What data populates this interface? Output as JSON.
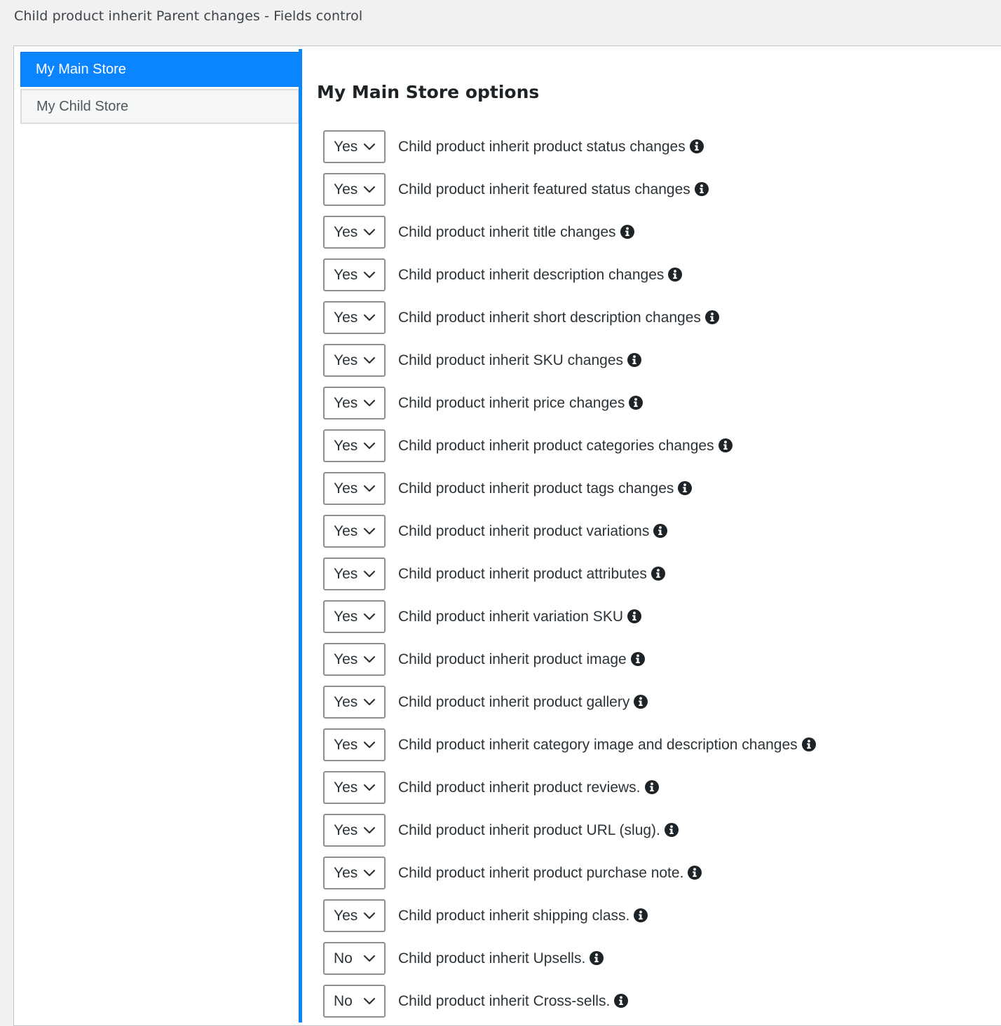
{
  "header": {
    "title": "Child product inherit Parent changes - Fields control"
  },
  "tabs": [
    {
      "label": "My Main Store",
      "active": true
    },
    {
      "label": "My Child Store",
      "active": false
    }
  ],
  "main": {
    "section_title": "My Main Store options",
    "options": [
      {
        "value": "Yes",
        "label": "Child product inherit product status changes"
      },
      {
        "value": "Yes",
        "label": "Child product inherit featured status changes"
      },
      {
        "value": "Yes",
        "label": "Child product inherit title changes"
      },
      {
        "value": "Yes",
        "label": "Child product inherit description changes"
      },
      {
        "value": "Yes",
        "label": "Child product inherit short description changes"
      },
      {
        "value": "Yes",
        "label": "Child product inherit SKU changes"
      },
      {
        "value": "Yes",
        "label": "Child product inherit price changes"
      },
      {
        "value": "Yes",
        "label": "Child product inherit product categories changes"
      },
      {
        "value": "Yes",
        "label": "Child product inherit product tags changes"
      },
      {
        "value": "Yes",
        "label": "Child product inherit product variations"
      },
      {
        "value": "Yes",
        "label": "Child product inherit product attributes"
      },
      {
        "value": "Yes",
        "label": "Child product inherit variation SKU"
      },
      {
        "value": "Yes",
        "label": "Child product inherit product image"
      },
      {
        "value": "Yes",
        "label": "Child product inherit product gallery"
      },
      {
        "value": "Yes",
        "label": "Child product inherit category image and description changes"
      },
      {
        "value": "Yes",
        "label": "Child product inherit product reviews."
      },
      {
        "value": "Yes",
        "label": "Child product inherit product URL (slug)."
      },
      {
        "value": "Yes",
        "label": "Child product inherit product purchase note."
      },
      {
        "value": "Yes",
        "label": "Child product inherit shipping class."
      },
      {
        "value": "No",
        "label": "Child product inherit Upsells."
      },
      {
        "value": "No",
        "label": "Child product inherit Cross-sells."
      }
    ]
  },
  "icons": {
    "info": "info-circle-icon",
    "dropdown": "chevron-down-icon"
  },
  "colors": {
    "accent": "#0a84ff",
    "text": "#2c3338"
  }
}
